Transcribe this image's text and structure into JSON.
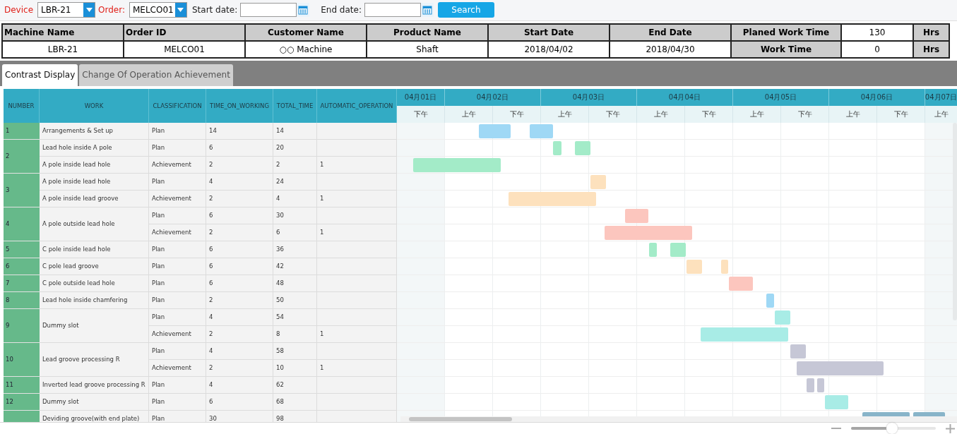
{
  "toolbar": {
    "device_label": "Device",
    "device": "LBR-21",
    "order_label": "Order:",
    "order": "MELCO01",
    "start_label": "Start date:",
    "end_label": "End date:",
    "search": "Search"
  },
  "info": {
    "headers": [
      "Machine Name",
      "Order ID",
      "Customer Name",
      "Product Name",
      "Start Date",
      "End Date"
    ],
    "values": [
      "LBR-21",
      "MELCO01",
      "○○ Machine",
      "Shaft",
      "2018/04/02",
      "2018/04/30"
    ],
    "summary": [
      {
        "label": "Planed Work Time",
        "value": "130",
        "unit": "Hrs"
      },
      {
        "label": "Work Time",
        "value": "0",
        "unit": "Hrs"
      }
    ]
  },
  "tabs": [
    {
      "label": "Contrast Display",
      "selected": true
    },
    {
      "label": "Change Of Operation Achievement",
      "selected": false
    }
  ],
  "table": {
    "columns": [
      "NUMBER",
      "WORK",
      "CLASSIFICATION",
      "TIME_ON_WORKING",
      "TOTAL_TIME",
      "AUTOMATIC_OPERATION"
    ],
    "groups": [
      {
        "number": "1",
        "items": [
          {
            "work": "Arrangements & Set up",
            "lines": [
              {
                "classification": "Plan",
                "time_on_working": "14",
                "total_time": "14"
              }
            ]
          }
        ]
      },
      {
        "number": "2",
        "items": [
          {
            "work": "Lead hole inside A pole",
            "lines": [
              {
                "classification": "Plan",
                "time_on_working": "6",
                "total_time": "20"
              }
            ]
          },
          {
            "work": "A pole inside lead hole",
            "lines": [
              {
                "classification": "Achievement",
                "time_on_working": "2",
                "total_time": "2",
                "automatic_operation": "1"
              }
            ]
          }
        ]
      },
      {
        "number": "3",
        "items": [
          {
            "work": "A pole inside lead hole",
            "lines": [
              {
                "classification": "Plan",
                "time_on_working": "4",
                "total_time": "24"
              }
            ]
          },
          {
            "work": "A pole inside lead groove",
            "lines": [
              {
                "classification": "Achievement",
                "time_on_working": "2",
                "total_time": "4",
                "automatic_operation": "1"
              }
            ]
          }
        ]
      },
      {
        "number": "4",
        "items": [
          {
            "work": "A pole outside lead hole",
            "lines": [
              {
                "classification": "Plan",
                "time_on_working": "6",
                "total_time": "30"
              },
              {
                "classification": "Achievement",
                "time_on_working": "2",
                "total_time": "6",
                "automatic_operation": "1"
              }
            ]
          }
        ]
      },
      {
        "number": "5",
        "items": [
          {
            "work": "C pole inside lead hole",
            "lines": [
              {
                "classification": "Plan",
                "time_on_working": "6",
                "total_time": "36"
              }
            ]
          }
        ]
      },
      {
        "number": "6",
        "items": [
          {
            "work": "C pole lead groove",
            "lines": [
              {
                "classification": "Plan",
                "time_on_working": "6",
                "total_time": "42"
              }
            ]
          }
        ]
      },
      {
        "number": "7",
        "items": [
          {
            "work": "C pole outside lead hole",
            "lines": [
              {
                "classification": "Plan",
                "time_on_working": "6",
                "total_time": "48"
              }
            ]
          }
        ]
      },
      {
        "number": "8",
        "items": [
          {
            "work": "Lead hole inside chamfering",
            "lines": [
              {
                "classification": "Plan",
                "time_on_working": "2",
                "total_time": "50"
              }
            ]
          }
        ]
      },
      {
        "number": "9",
        "items": [
          {
            "work": "Dummy slot",
            "lines": [
              {
                "classification": "Plan",
                "time_on_working": "4",
                "total_time": "54"
              },
              {
                "classification": "Achievement",
                "time_on_working": "2",
                "total_time": "8",
                "automatic_operation": "1"
              }
            ]
          }
        ]
      },
      {
        "number": "10",
        "items": [
          {
            "work": "Lead groove processing R",
            "lines": [
              {
                "classification": "Plan",
                "time_on_working": "4",
                "total_time": "58"
              },
              {
                "classification": "Achievement",
                "time_on_working": "2",
                "total_time": "10",
                "automatic_operation": "1"
              }
            ]
          }
        ]
      },
      {
        "number": "11",
        "items": [
          {
            "work": "Inverted lead groove processing R",
            "lines": [
              {
                "classification": "Plan",
                "time_on_working": "4",
                "total_time": "62"
              }
            ]
          }
        ]
      },
      {
        "number": "12",
        "items": [
          {
            "work": "Dummy slot",
            "lines": [
              {
                "classification": "Plan",
                "time_on_working": "6",
                "total_time": "68"
              }
            ]
          }
        ]
      },
      {
        "items": [
          {
            "work": "Deviding groove(with end plate)",
            "lines": [
              {
                "classification": "Plan",
                "time_on_working": "30",
                "total_time": "98"
              }
            ]
          }
        ]
      }
    ]
  },
  "timeline": {
    "days": [
      {
        "label": "04月01日",
        "halves": [
          "下午"
        ]
      },
      {
        "label": "04月02日",
        "halves": [
          "上午",
          "下午"
        ]
      },
      {
        "label": "04月03日",
        "halves": [
          "上午",
          "下午"
        ]
      },
      {
        "label": "04月04日",
        "halves": [
          "上午",
          "下午"
        ]
      },
      {
        "label": "04月05日",
        "halves": [
          "上午",
          "下午"
        ]
      },
      {
        "label": "04月06日",
        "halves": [
          "上午",
          "下午"
        ]
      },
      {
        "label": "04月07日",
        "halves": [
          "上午"
        ]
      }
    ]
  },
  "zoom_slider": {
    "level": 0.48
  }
}
